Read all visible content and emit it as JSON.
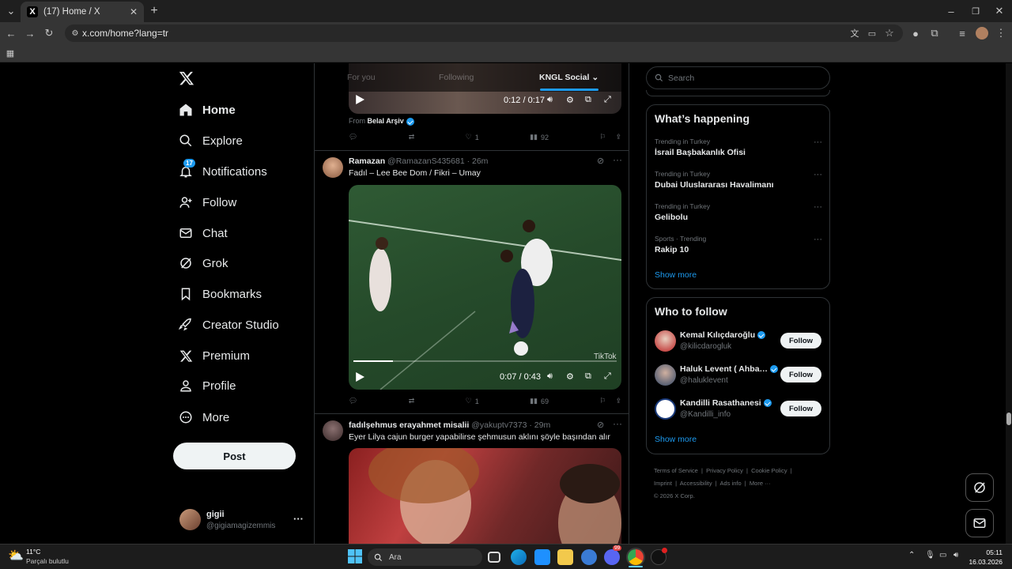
{
  "browser": {
    "tab_count_title": "(17) Home / X",
    "url": "x.com/home?lang=tr"
  },
  "nav": {
    "items": [
      {
        "label": "Home",
        "icon": "home-icon"
      },
      {
        "label": "Explore",
        "icon": "search-icon"
      },
      {
        "label": "Notifications",
        "icon": "bell-icon",
        "badge": "17"
      },
      {
        "label": "Follow",
        "icon": "person-add-icon"
      },
      {
        "label": "Chat",
        "icon": "mail-icon"
      },
      {
        "label": "Grok",
        "icon": "grok-icon"
      },
      {
        "label": "Bookmarks",
        "icon": "bookmark-icon"
      },
      {
        "label": "Creator Studio",
        "icon": "rocket-icon"
      },
      {
        "label": "Premium",
        "icon": "x-icon"
      },
      {
        "label": "Profile",
        "icon": "profile-icon"
      },
      {
        "label": "More",
        "icon": "more-circle-icon"
      }
    ],
    "post_label": "Post",
    "account": {
      "name": "gigii",
      "handle": "@gigiamagizemmis"
    }
  },
  "timeline": {
    "tabs": [
      "For you",
      "Following",
      "KNGL Social"
    ],
    "post0": {
      "time": "0:12 / 0:17",
      "from_prefix": "From",
      "from_name": "Belal Arşiv",
      "likes": "1",
      "views": "92"
    },
    "post1": {
      "name": "Ramazan",
      "handle": "@RamazanS435681",
      "age": "· 26m",
      "text": "Fadıl – Lee Bee Dom / Fikri – Umay",
      "time": "0:07 / 0:43",
      "watermark": "TikTok",
      "likes": "1",
      "views": "69"
    },
    "post2": {
      "name": "fadılşehmus erayahmet misalii",
      "handle": "@yakuptv7373",
      "age": "· 29m",
      "text": "Eyer Lilya cajun burger yapabilirse şehmusun aklını şöyle başından alır"
    }
  },
  "sidebar": {
    "search_placeholder": "Search",
    "happening_title": "What’s happening",
    "trends": [
      {
        "context": "Trending in Turkey",
        "title": "İsrail Başbakanlık Ofisi"
      },
      {
        "context": "Trending in Turkey",
        "title": "Dubai Uluslararası Havalimanı"
      },
      {
        "context": "Trending in Turkey",
        "title": "Gelibolu"
      },
      {
        "context": "Sports · Trending",
        "title": "Rakip 10"
      }
    ],
    "show_more": "Show more",
    "who_title": "Who to follow",
    "follow_label": "Follow",
    "who": [
      {
        "name": "Kemal Kılıçdaroğlu",
        "handle": "@kilicdarogluk"
      },
      {
        "name": "Haluk Levent ( Ahba…",
        "handle": "@haluklevent"
      },
      {
        "name": "Kandilli Rasathanesi",
        "handle": "@Kandilli_info"
      }
    ],
    "show_more2": "Show more",
    "footer": [
      "Terms of Service",
      "Privacy Policy",
      "Cookie Policy",
      "Imprint",
      "Accessibility",
      "Ads info",
      "More ···",
      "© 2026 X Corp."
    ]
  },
  "taskbar": {
    "weather_temp": "11°C",
    "weather_desc": "Parçalı bulutlu",
    "search": "Ara",
    "time": "05:11",
    "date": "16.03.2026",
    "discord_badge": "99"
  },
  "colors": {
    "accent": "#1d9bf0",
    "bg": "#000000",
    "border": "#2f3336",
    "muted": "#71767b"
  }
}
